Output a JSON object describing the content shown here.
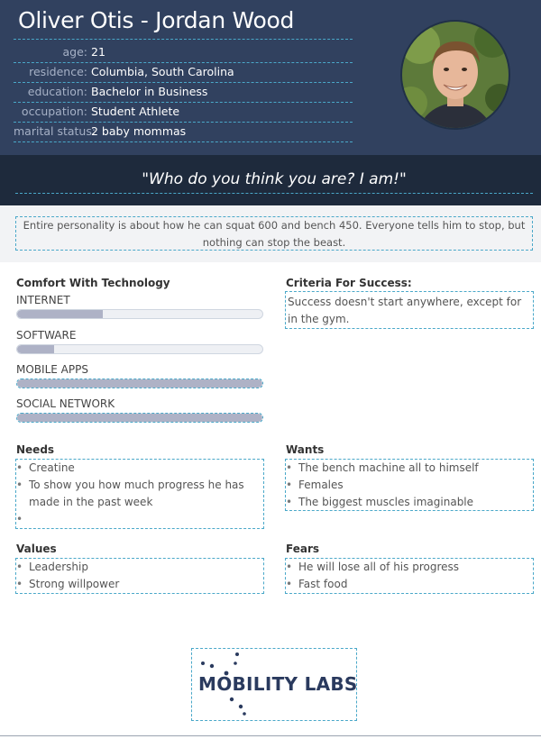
{
  "persona": {
    "name": "Oliver Otis - Jordan Wood",
    "fields": [
      {
        "label": "age:",
        "value": "21"
      },
      {
        "label": "residence:",
        "value": "Columbia, South Carolina"
      },
      {
        "label": "education:",
        "value": "Bachelor in Business"
      },
      {
        "label": "occupation:",
        "value": "Student Athlete"
      },
      {
        "label": "marital status:",
        "value": "2 baby mommas"
      }
    ],
    "quote": "\"Who do you think you are? I am!\"",
    "bio": "Entire personality is about how he can squat 600 and bench 450. Everyone tells him to stop, but nothing can stop the beast."
  },
  "comfort": {
    "title": "Comfort With Technology",
    "items": [
      {
        "label": "INTERNET",
        "level": 0.35
      },
      {
        "label": "SOFTWARE",
        "level": 0.15
      },
      {
        "label": "MOBILE APPS",
        "level": 1.0
      },
      {
        "label": "SOCIAL NETWORK",
        "level": 1.0
      }
    ]
  },
  "criteria": {
    "title": "Criteria For Success:",
    "text": "Success doesn't start anywhere, except for in the gym."
  },
  "needs": {
    "title": "Needs",
    "items": [
      "Creatine",
      "To show you how much progress he has made in the past week",
      ""
    ]
  },
  "wants": {
    "title": "Wants",
    "items": [
      "The bench machine all to himself",
      "Females",
      "The biggest muscles imaginable"
    ]
  },
  "values": {
    "title": "Values",
    "items": [
      "Leadership",
      "Strong willpower"
    ]
  },
  "fears": {
    "title": "Fears",
    "items": [
      "He will lose all of his progress",
      "Fast food"
    ]
  },
  "logo": {
    "text": "MOBILITY LABS"
  },
  "colors": {
    "header": "#31415f",
    "quote_band": "#1e2a3c",
    "accent": "#4aa8c9",
    "bar_fill": "#aeb2c6"
  }
}
